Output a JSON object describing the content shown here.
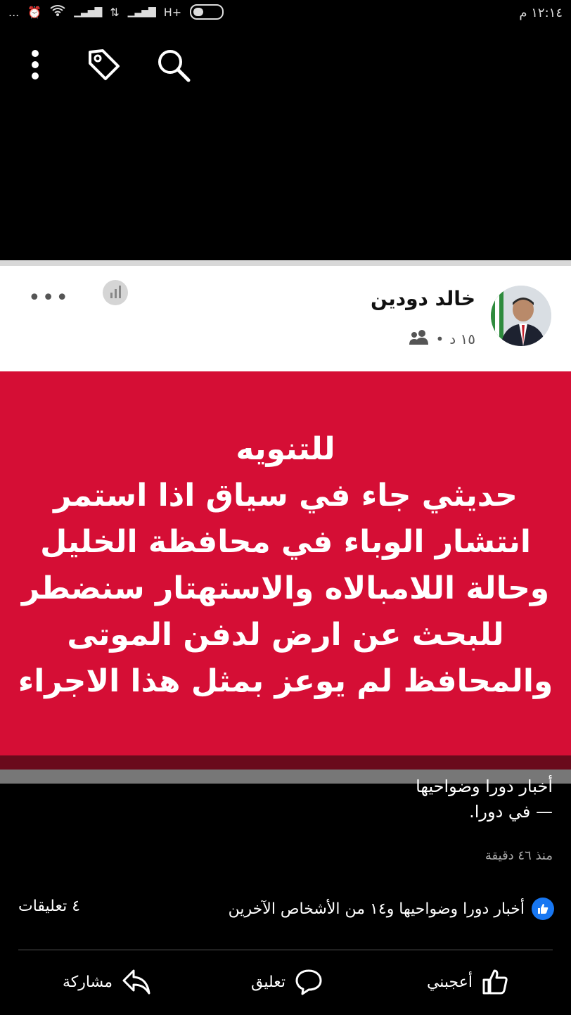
{
  "status_bar": {
    "time": "١٢:١٤ م",
    "network": "H+",
    "more": "..."
  },
  "toolbar": {
    "menu_icon": "more-vertical-icon",
    "tag_icon": "tag-icon",
    "search_icon": "search-icon"
  },
  "post": {
    "author": "خالد دودين",
    "time": "١٥ د",
    "audience_icon": "friends-icon",
    "image_lines": [
      "للتنويه",
      "حديثي جاء في سياق اذا استمر",
      "انتشار الوباء في محافظة الخليل",
      "وحالة اللامبالاه والاستهتار سنضطر",
      "للبحث عن ارض لدفن الموتى",
      "والمحافظ لم يوعز  بمثل هذا الاجراء"
    ],
    "image_bg": "#d50e35"
  },
  "caption": {
    "line1": "أخبار دورا وضواحيها",
    "line2": "— في دورا.",
    "time_ago": "منذ ٤٦ دقيقة"
  },
  "reactions": {
    "summary": "أخبار دورا وضواحيها و١٤ من الأشخاص الآخرين",
    "comments": "٤ تعليقات"
  },
  "actions": {
    "like": "أعجبني",
    "comment": "تعليق",
    "share": "مشاركة"
  },
  "colors": {
    "like_blue": "#1877f2"
  }
}
